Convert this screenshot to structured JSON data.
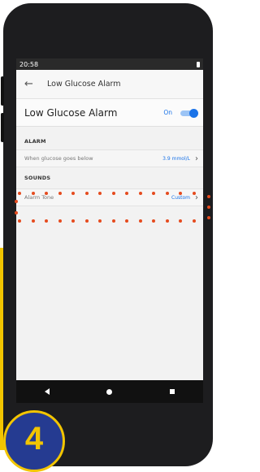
{
  "status": {
    "time": "20:58"
  },
  "appbar": {
    "back_icon": "arrow-left-icon",
    "title": "Low Glucose Alarm"
  },
  "main": {
    "label": "Low Glucose Alarm",
    "toggle_text": "On",
    "toggle_state": "on"
  },
  "alarm_section": {
    "header": "ALARM",
    "row_label": "When glucose goes below",
    "row_value": "3.9 mmol/L"
  },
  "sounds_section": {
    "header": "SOUNDS",
    "row_label": "Alarm Tone",
    "row_value": "Custom"
  },
  "badge": {
    "number": "4"
  },
  "colors": {
    "accent": "#1a73e8",
    "highlight_dots": "#e54b1e",
    "badge_bg": "#253b91",
    "badge_fg": "#f2c500"
  }
}
